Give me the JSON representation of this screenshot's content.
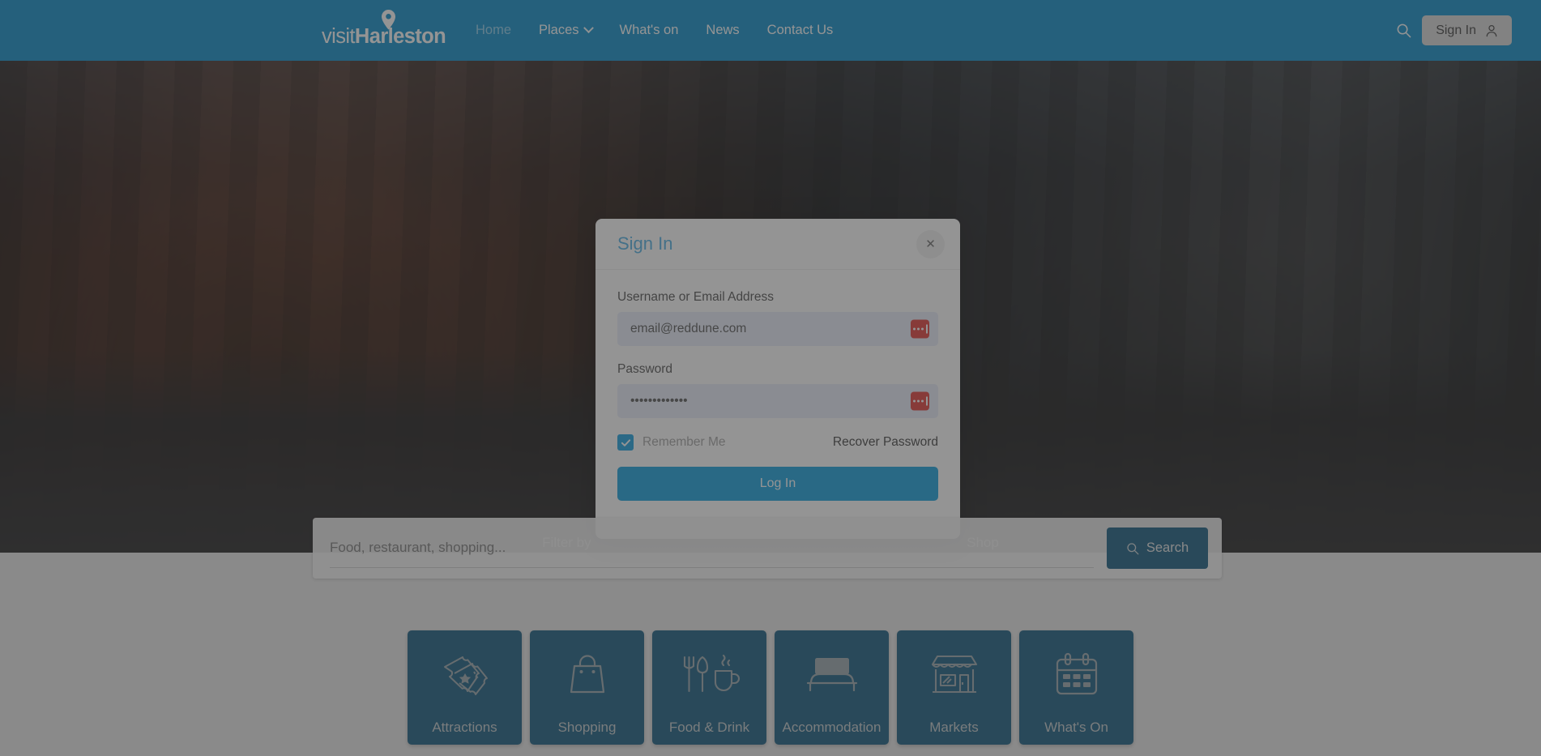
{
  "header": {
    "logo": {
      "prefix": "visit",
      "name": "Harleston",
      "pin_icon": "map-pin-icon"
    },
    "nav": [
      {
        "label": "Home",
        "active": true,
        "has_chevron": false
      },
      {
        "label": "Places",
        "active": false,
        "has_chevron": true
      },
      {
        "label": "What's on",
        "active": false,
        "has_chevron": false
      },
      {
        "label": "News",
        "active": false,
        "has_chevron": false
      },
      {
        "label": "Contact Us",
        "active": false,
        "has_chevron": false
      }
    ],
    "search_icon": "search-icon",
    "signin_label": "Sign In",
    "signin_icon": "user-icon",
    "background_color": "#0b8dc9"
  },
  "hero": {
    "filter_text_left": "Filter by",
    "filter_text_right": "Shop",
    "overlay_color": "rgba(0,0,0,0.46)"
  },
  "search_panel": {
    "placeholder": "Food, restaurant, shopping...",
    "value": "",
    "button_label": "Search",
    "button_icon": "search-icon",
    "button_color": "#125a7e"
  },
  "categories": [
    {
      "label": "Attractions",
      "icon": "tickets-icon"
    },
    {
      "label": "Shopping",
      "icon": "shopping-bag-icon"
    },
    {
      "label": "Food & Drink",
      "icon": "cutlery-mug-icon"
    },
    {
      "label": "Accommodation",
      "icon": "bed-icon"
    },
    {
      "label": "Markets",
      "icon": "storefront-icon"
    },
    {
      "label": "What's On",
      "icon": "calendar-icon"
    }
  ],
  "modal": {
    "title": "Sign In",
    "close_icon": "close-icon",
    "username": {
      "label": "Username or Email Address",
      "value": "email@reddune.com",
      "placeholder": "Username or Email Address",
      "manager_icon": "password-manager-icon"
    },
    "password": {
      "label": "Password",
      "value": "•••••••••••••",
      "placeholder": "Password",
      "manager_icon": "password-manager-icon"
    },
    "remember_label": "Remember Me",
    "remember_checked": true,
    "recover_label": "Recover Password",
    "submit_label": "Log In",
    "accent_color": "#13a0de",
    "title_color": "#4fb0e4"
  }
}
